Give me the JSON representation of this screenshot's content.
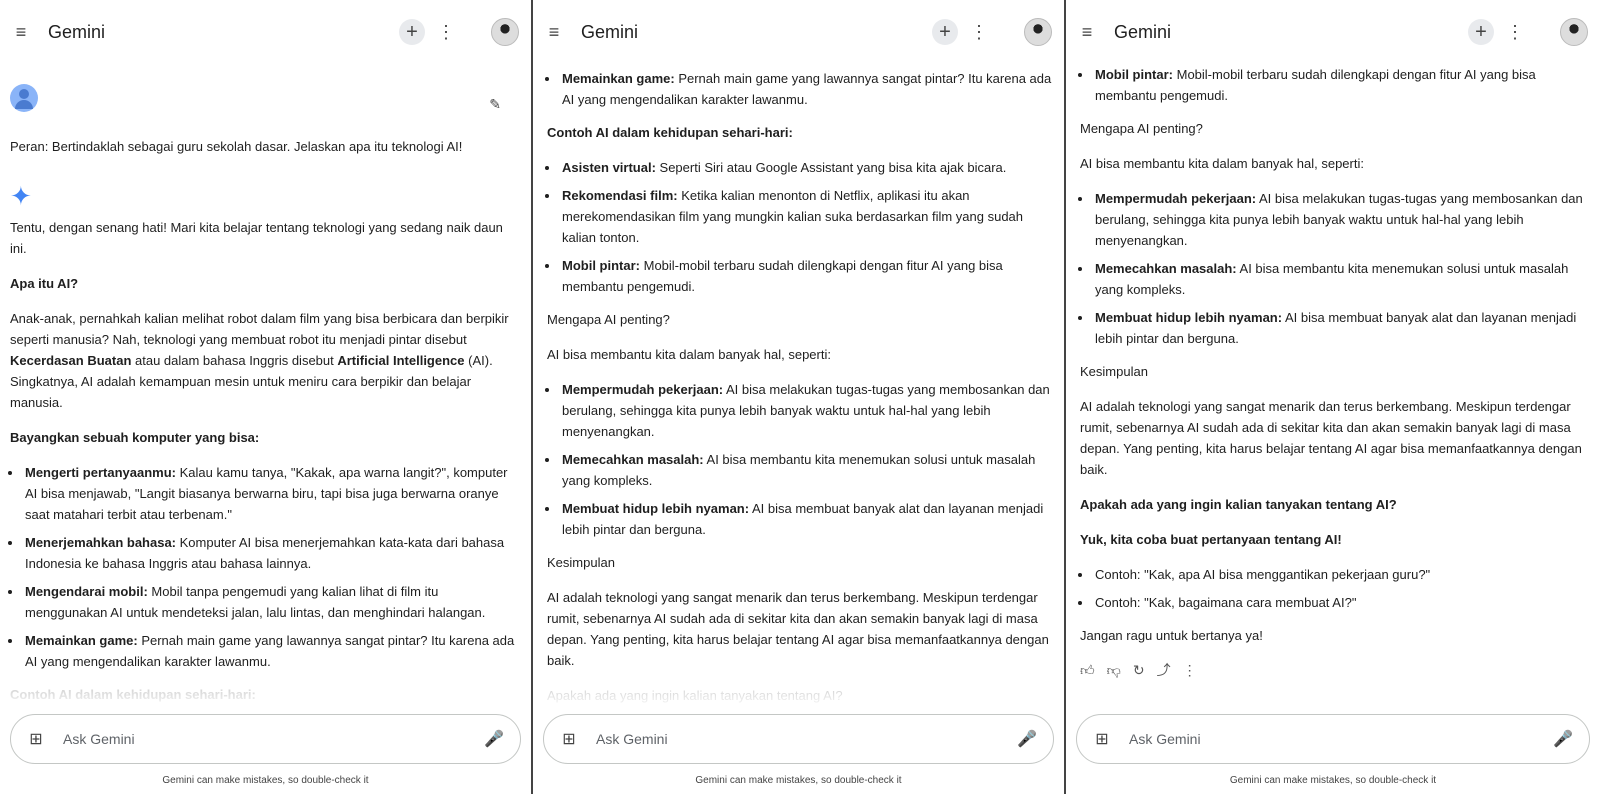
{
  "app_title": "Gemini",
  "input_placeholder": "Ask Gemini",
  "disclaimer": "Gemini can make mistakes, so double-check it",
  "user_prompt": "Peran: Bertindaklah sebagai guru sekolah dasar. Jelaskan apa itu teknologi AI!",
  "intro": "Tentu, dengan senang hati! Mari kita belajar tentang teknologi yang sedang naik daun ini.",
  "h_apa": "Apa itu AI?",
  "para_apa": {
    "a": "Anak-anak, pernahkah kalian melihat robot dalam film yang bisa berbicara dan berpikir seperti manusia? Nah, teknologi yang membuat robot itu menjadi pintar disebut ",
    "b": "Kecerdasan Buatan",
    "c": " atau dalam bahasa Inggris disebut ",
    "d": "Artificial Intelligence",
    "e": " (AI). Singkatnya, AI adalah kemampuan mesin untuk meniru cara berpikir dan belajar manusia."
  },
  "h_bayangkan": "Bayangkan sebuah komputer yang bisa:",
  "bayangkan_items": [
    {
      "b": "Mengerti pertanyaanmu:",
      "t": " Kalau kamu tanya, \"Kakak, apa warna langit?\", komputer AI bisa menjawab, \"Langit biasanya berwarna biru, tapi bisa juga berwarna oranye saat matahari terbit atau terbenam.\""
    },
    {
      "b": "Menerjemahkan bahasa:",
      "t": " Komputer AI bisa menerjemahkan kata-kata dari bahasa Indonesia ke bahasa Inggris atau bahasa lainnya."
    },
    {
      "b": "Mengendarai mobil:",
      "t": " Mobil tanpa pengemudi yang kalian lihat di film itu menggunakan AI untuk mendeteksi jalan, lalu lintas, dan menghindari halangan."
    },
    {
      "b": "Memainkan game:",
      "t": " Pernah main game yang lawannya sangat pintar? Itu karena ada AI yang mengendalikan karakter lawanmu."
    }
  ],
  "h_contoh": "Contoh AI dalam kehidupan sehari-hari:",
  "contoh_items": [
    {
      "b": "Asisten virtual:",
      "t": " Seperti Siri atau Google Assistant yang bisa kita ajak bicara."
    },
    {
      "b": "Rekomendasi film:",
      "t": " Ketika kalian menonton di Netflix, aplikasi itu akan merekomendasikan film yang mungkin kalian suka berdasarkan film yang sudah kalian tonton."
    },
    {
      "b": "Mobil pintar:",
      "t": " Mobil-mobil terbaru sudah dilengkapi dengan fitur AI yang bisa membantu pengemudi."
    }
  ],
  "h_mengapa": "Mengapa AI penting?",
  "mengapa_intro": "AI bisa membantu kita dalam banyak hal, seperti:",
  "mengapa_items": [
    {
      "b": "Mempermudah pekerjaan:",
      "t": " AI bisa melakukan tugas-tugas yang membosankan dan berulang, sehingga kita punya lebih banyak waktu untuk hal-hal yang lebih menyenangkan."
    },
    {
      "b": "Memecahkan masalah:",
      "t": " AI bisa membantu kita menemukan solusi untuk masalah yang kompleks."
    },
    {
      "b": "Membuat hidup lebih nyaman:",
      "t": " AI bisa membuat banyak alat dan layanan menjadi lebih pintar dan berguna."
    }
  ],
  "h_kesimpulan": "Kesimpulan",
  "kesimpulan": "AI adalah teknologi yang sangat menarik dan terus berkembang. Meskipun terdengar rumit, sebenarnya AI sudah ada di sekitar kita dan akan semakin banyak lagi di masa depan. Yang penting, kita harus belajar tentang AI agar bisa memanfaatkannya dengan baik.",
  "h_apakah": "Apakah ada yang ingin kalian tanyakan tentang AI?",
  "h_yuk": "Yuk, kita coba buat pertanyaan tentang AI!",
  "yuk_items": [
    "Contoh: \"Kak, apa AI bisa menggantikan pekerjaan guru?\"",
    "Contoh: \"Kak, bagaimana cara membuat AI?\""
  ],
  "closing": "Jangan ragu untuk bertanya ya!",
  "icons": [
    "menu-icon",
    "plus-icon",
    "more-vert-icon",
    "pencil-icon",
    "sparkle-icon",
    "thumb-up-icon",
    "thumb-down-icon",
    "regenerate-icon",
    "share-icon",
    "add-image-icon",
    "mic-icon"
  ],
  "accent_color": "#4285f4"
}
